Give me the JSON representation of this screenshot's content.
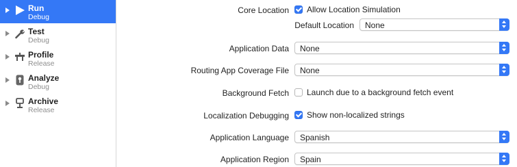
{
  "sidebar": {
    "items": [
      {
        "name": "Run",
        "config": "Debug",
        "icon": "play-icon",
        "selected": true
      },
      {
        "name": "Test",
        "config": "Debug",
        "icon": "wrench-icon",
        "selected": false
      },
      {
        "name": "Profile",
        "config": "Release",
        "icon": "instruments-icon",
        "selected": false
      },
      {
        "name": "Analyze",
        "config": "Debug",
        "icon": "analyze-icon",
        "selected": false
      },
      {
        "name": "Archive",
        "config": "Release",
        "icon": "archive-icon",
        "selected": false
      }
    ]
  },
  "settings": {
    "core_location": {
      "label": "Core Location",
      "checkbox_label": "Allow Location Simulation",
      "checked": true
    },
    "default_location": {
      "label": "Default Location",
      "value": "None"
    },
    "application_data": {
      "label": "Application Data",
      "value": "None"
    },
    "routing_coverage": {
      "label": "Routing App Coverage File",
      "value": "None"
    },
    "background_fetch": {
      "label": "Background Fetch",
      "checkbox_label": "Launch due to a background fetch event",
      "checked": false
    },
    "localization_debugging": {
      "label": "Localization Debugging",
      "checkbox_label": "Show non-localized strings",
      "checked": true
    },
    "application_language": {
      "label": "Application Language",
      "value": "Spanish"
    },
    "application_region": {
      "label": "Application Region",
      "value": "Spain"
    }
  },
  "colors": {
    "accent": "#3478f6"
  }
}
